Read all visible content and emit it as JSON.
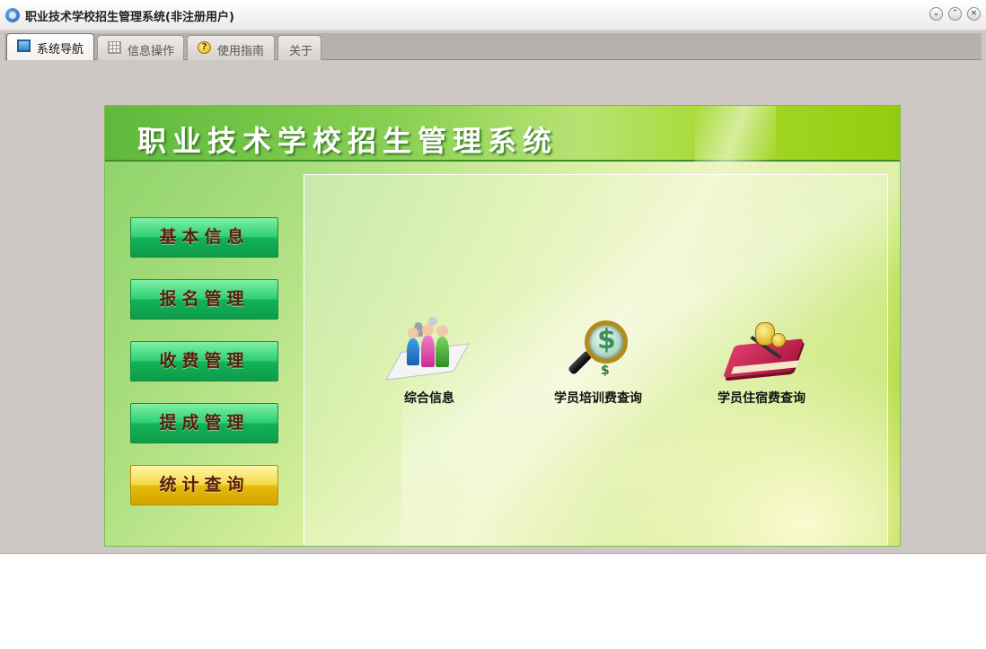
{
  "window": {
    "title": "职业技术学校招生管理系统(非注册用户)",
    "controls": {
      "minimize": "⌄",
      "maximize": "⌃",
      "close": "×"
    }
  },
  "tabs": [
    {
      "label": "系统导航",
      "icon": "monitor-icon",
      "active": true
    },
    {
      "label": "信息操作",
      "icon": "grid-icon",
      "active": false
    },
    {
      "label": "使用指南",
      "icon": "help-icon",
      "active": false
    },
    {
      "label": "关于",
      "icon": "",
      "active": false
    }
  ],
  "help_icon_glyph": "?",
  "banner": {
    "title": "职业技术学校招生管理系统"
  },
  "nav": [
    {
      "label": "基本信息",
      "selected": false
    },
    {
      "label": "报名管理",
      "selected": false
    },
    {
      "label": "收费管理",
      "selected": false
    },
    {
      "label": "提成管理",
      "selected": false
    },
    {
      "label": "统计查询",
      "selected": true
    }
  ],
  "functions": [
    {
      "label": "综合信息",
      "icon": "people-icon"
    },
    {
      "label": "学员培训费查询",
      "icon": "magnifier-dollar-icon"
    },
    {
      "label": "学员住宿费查询",
      "icon": "book-coins-icon"
    }
  ],
  "icon_text": {
    "dollar": "$",
    "small_dollar": "$"
  },
  "colors": {
    "nav_green": "#12b358",
    "nav_selected_gold": "#e6bb0c",
    "banner_green": "#86cf52",
    "title_text": "#ffffff"
  }
}
